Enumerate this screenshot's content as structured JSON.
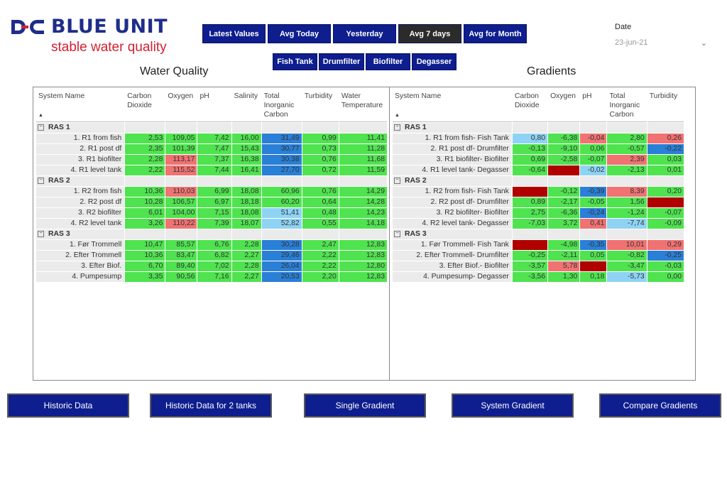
{
  "logo": {
    "name": "BLUE UNIT",
    "tagline": "stable water quality"
  },
  "periods": [
    {
      "label": "Latest Values",
      "active": false,
      "w": 89
    },
    {
      "label": "Avg Today",
      "active": false,
      "w": 89
    },
    {
      "label": "Yesterday",
      "active": false,
      "w": 89
    },
    {
      "label": "Avg 7 days",
      "active": true,
      "w": 89
    },
    {
      "label": "Avg for Month",
      "active": false,
      "w": 89
    }
  ],
  "units": [
    {
      "label": "Fish Tank"
    },
    {
      "label": "Drumfilter"
    },
    {
      "label": "Biofilter"
    },
    {
      "label": "Degasser"
    }
  ],
  "date": {
    "label": "Date",
    "value": "23-jun-21"
  },
  "water_quality": {
    "title": "Water Quality",
    "columns": [
      "System Name",
      "Carbon Dioxide",
      "Oxygen",
      "pH",
      "Salinity",
      "Total Inorganic Carbon",
      "Turbidity",
      "Water Temperature"
    ],
    "groups": [
      {
        "name": "RAS 1",
        "rows": [
          {
            "name": "1. R1 from fish",
            "cells": [
              [
                "2,53",
                "g"
              ],
              [
                "109,05",
                "g"
              ],
              [
                "7,42",
                "g"
              ],
              [
                "16,00",
                "g"
              ],
              [
                "31,49",
                "b"
              ],
              [
                "0,99",
                "g"
              ],
              [
                "11,41",
                "g"
              ]
            ]
          },
          {
            "name": "2. R1 post df",
            "cells": [
              [
                "2,35",
                "g"
              ],
              [
                "101,39",
                "g"
              ],
              [
                "7,47",
                "g"
              ],
              [
                "15,43",
                "g"
              ],
              [
                "30,77",
                "b"
              ],
              [
                "0,73",
                "g"
              ],
              [
                "11,28",
                "g"
              ]
            ]
          },
          {
            "name": "3. R1 biofilter",
            "cells": [
              [
                "2,28",
                "g"
              ],
              [
                "113,17",
                "r"
              ],
              [
                "7,37",
                "g"
              ],
              [
                "16,38",
                "g"
              ],
              [
                "30,38",
                "b"
              ],
              [
                "0,76",
                "g"
              ],
              [
                "11,68",
                "g"
              ]
            ]
          },
          {
            "name": "4. R1 level tank",
            "cells": [
              [
                "2,22",
                "g"
              ],
              [
                "115,52",
                "r"
              ],
              [
                "7,44",
                "g"
              ],
              [
                "16,41",
                "g"
              ],
              [
                "27,70",
                "b"
              ],
              [
                "0,72",
                "g"
              ],
              [
                "11,59",
                "g"
              ]
            ]
          }
        ]
      },
      {
        "name": "RAS 2",
        "rows": [
          {
            "name": "1. R2 from fish",
            "cells": [
              [
                "10,36",
                "g"
              ],
              [
                "110,03",
                "r"
              ],
              [
                "6,99",
                "g"
              ],
              [
                "18,08",
                "g"
              ],
              [
                "60,96",
                "g"
              ],
              [
                "0,76",
                "g"
              ],
              [
                "14,29",
                "g"
              ]
            ]
          },
          {
            "name": "2. R2 post df",
            "cells": [
              [
                "10,28",
                "g"
              ],
              [
                "106,57",
                "g"
              ],
              [
                "6,97",
                "g"
              ],
              [
                "18,18",
                "g"
              ],
              [
                "60,20",
                "g"
              ],
              [
                "0,64",
                "g"
              ],
              [
                "14,28",
                "g"
              ]
            ]
          },
          {
            "name": "3. R2 biofilter",
            "cells": [
              [
                "6,01",
                "g"
              ],
              [
                "104,00",
                "g"
              ],
              [
                "7,15",
                "g"
              ],
              [
                "18,08",
                "g"
              ],
              [
                "51,41",
                "lb"
              ],
              [
                "0,48",
                "g"
              ],
              [
                "14,23",
                "g"
              ]
            ]
          },
          {
            "name": "4. R2 level tank",
            "cells": [
              [
                "3,26",
                "g"
              ],
              [
                "110,22",
                "r"
              ],
              [
                "7,39",
                "g"
              ],
              [
                "18,07",
                "g"
              ],
              [
                "52,82",
                "lb"
              ],
              [
                "0,55",
                "g"
              ],
              [
                "14,18",
                "g"
              ]
            ]
          }
        ]
      },
      {
        "name": "RAS 3",
        "rows": [
          {
            "name": "1. Før Trommell",
            "cells": [
              [
                "10,47",
                "g"
              ],
              [
                "85,57",
                "g"
              ],
              [
                "6,76",
                "g"
              ],
              [
                "2,28",
                "g"
              ],
              [
                "30,28",
                "b"
              ],
              [
                "2,47",
                "g"
              ],
              [
                "12,83",
                "g"
              ]
            ]
          },
          {
            "name": "2. Efter Trommell",
            "cells": [
              [
                "10,36",
                "g"
              ],
              [
                "83,47",
                "g"
              ],
              [
                "6,82",
                "g"
              ],
              [
                "2,27",
                "g"
              ],
              [
                "29,46",
                "b"
              ],
              [
                "2,22",
                "g"
              ],
              [
                "12,83",
                "g"
              ]
            ]
          },
          {
            "name": "3. Efter Biof.",
            "cells": [
              [
                "6,70",
                "g"
              ],
              [
                "89,40",
                "g"
              ],
              [
                "7,02",
                "g"
              ],
              [
                "2,28",
                "g"
              ],
              [
                "26,04",
                "b"
              ],
              [
                "2,22",
                "g"
              ],
              [
                "12,80",
                "g"
              ]
            ]
          },
          {
            "name": "4. Pumpesump",
            "cells": [
              [
                "3,35",
                "g"
              ],
              [
                "90,56",
                "g"
              ],
              [
                "7,16",
                "g"
              ],
              [
                "2,27",
                "g"
              ],
              [
                "20,53",
                "b"
              ],
              [
                "2,20",
                "g"
              ],
              [
                "12,83",
                "g"
              ]
            ]
          }
        ]
      }
    ]
  },
  "gradients": {
    "title": "Gradients",
    "columns": [
      "System Name",
      "Carbon Dioxide",
      "Oxygen",
      "pH",
      "Total Inorganic Carbon",
      "Turbidity"
    ],
    "groups": [
      {
        "name": "RAS 1",
        "rows": [
          {
            "name": "1. R1 from fish- Fish Tank",
            "cells": [
              [
                "0,80",
                "lb"
              ],
              [
                "-6,38",
                "g"
              ],
              [
                "-0,04",
                "r"
              ],
              [
                "2,80",
                "g"
              ],
              [
                "0,26",
                "r"
              ]
            ]
          },
          {
            "name": "2. R1 post df- Drumfilter",
            "cells": [
              [
                "-0,13",
                "g"
              ],
              [
                "-9,10",
                "g"
              ],
              [
                "0,06",
                "g"
              ],
              [
                "-0,57",
                "g"
              ],
              [
                "-0,22",
                "b"
              ]
            ]
          },
          {
            "name": "3. R1 biofilter- Biofilter",
            "cells": [
              [
                "0,69",
                "g"
              ],
              [
                "-2,58",
                "g"
              ],
              [
                "-0,07",
                "g"
              ],
              [
                "2,39",
                "r"
              ],
              [
                "0,03",
                "g"
              ]
            ]
          },
          {
            "name": "4. R1 level tank- Degasser",
            "cells": [
              [
                "-0,64",
                "g"
              ],
              [
                "",
                "dr"
              ],
              [
                "-0,02",
                "lb"
              ],
              [
                "-2,13",
                "g"
              ],
              [
                "0,01",
                "g"
              ]
            ]
          }
        ]
      },
      {
        "name": "RAS 2",
        "rows": [
          {
            "name": "1. R2 from fish- Fish Tank",
            "cells": [
              [
                "",
                "dr"
              ],
              [
                "-0,12",
                "g"
              ],
              [
                "-0,39",
                "b"
              ],
              [
                "8,39",
                "r"
              ],
              [
                "0,20",
                "g"
              ]
            ]
          },
          {
            "name": "2. R2 post df- Drumfilter",
            "cells": [
              [
                "0,89",
                "g"
              ],
              [
                "-2,17",
                "g"
              ],
              [
                "-0,05",
                "g"
              ],
              [
                "1,56",
                "g"
              ],
              [
                "",
                "dr"
              ]
            ]
          },
          {
            "name": "3. R2 biofilter- Biofilter",
            "cells": [
              [
                "2,75",
                "g"
              ],
              [
                "-6,36",
                "g"
              ],
              [
                "-0,24",
                "b"
              ],
              [
                "-1,24",
                "g"
              ],
              [
                "-0,07",
                "g"
              ]
            ]
          },
          {
            "name": "4. R2 level tank- Degasser",
            "cells": [
              [
                "-7,03",
                "g"
              ],
              [
                "3,72",
                "g"
              ],
              [
                "0,41",
                "r"
              ],
              [
                "-7,74",
                "lb"
              ],
              [
                "-0,09",
                "g"
              ]
            ]
          }
        ]
      },
      {
        "name": "RAS 3",
        "rows": [
          {
            "name": "1. Før Trommell- Fish Tank",
            "cells": [
              [
                "",
                "dr"
              ],
              [
                "-4,98",
                "g"
              ],
              [
                "-0,35",
                "b"
              ],
              [
                "10,01",
                "r"
              ],
              [
                "0,29",
                "r"
              ]
            ]
          },
          {
            "name": "2. Efter Trommell- Drumfilter",
            "cells": [
              [
                "-0,25",
                "g"
              ],
              [
                "-2,11",
                "g"
              ],
              [
                "0,05",
                "g"
              ],
              [
                "-0,82",
                "g"
              ],
              [
                "-0,25",
                "b"
              ]
            ]
          },
          {
            "name": "3. Efter Biof.- Biofilter",
            "cells": [
              [
                "-3,57",
                "g"
              ],
              [
                "5,78",
                "r"
              ],
              [
                "",
                "dr"
              ],
              [
                "-3,47",
                "g"
              ],
              [
                "-0,03",
                "g"
              ]
            ]
          },
          {
            "name": "4. Pumpesump- Degasser",
            "cells": [
              [
                "-3,56",
                "g"
              ],
              [
                "1,30",
                "g"
              ],
              [
                "0,18",
                "g"
              ],
              [
                "-5,73",
                "lb"
              ],
              [
                "0,00",
                "g"
              ]
            ]
          }
        ]
      }
    ]
  },
  "cell_colors": {
    "g": "#4fe34f",
    "r": "#f07272",
    "b": "#2a7fd6",
    "lb": "#8fd3f4",
    "dr": "#b00000"
  },
  "buttons": [
    "Historic Data",
    "Historic Data for 2 tanks",
    "Single Gradient",
    "System Gradient",
    "Compare Gradients"
  ]
}
